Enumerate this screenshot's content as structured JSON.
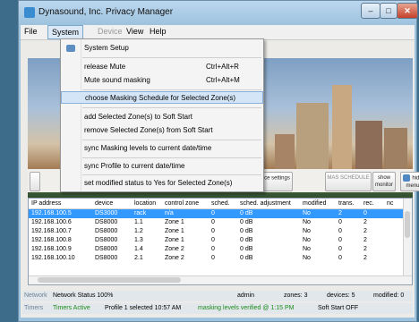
{
  "window": {
    "title": "Dynasound, Inc. Privacy Manager"
  },
  "menubar": {
    "file": "File",
    "system": "System",
    "device": "Device",
    "view": "View",
    "help": "Help"
  },
  "system_menu": [
    {
      "label": "System Setup",
      "shortcut": ""
    },
    {
      "label": "release Mute",
      "shortcut": "Ctrl+Alt+R"
    },
    {
      "label": "Mute sound masking",
      "shortcut": "Ctrl+Alt+M"
    },
    {
      "label": "choose Masking Schedule for Selected Zone(s)",
      "shortcut": ""
    },
    {
      "label": "add Selected Zone(s) to Soft Start",
      "shortcut": ""
    },
    {
      "label": "remove Selected Zone(s) from Soft Start",
      "shortcut": ""
    },
    {
      "label": "sync Masking levels to current date/time",
      "shortcut": ""
    },
    {
      "label": "sync Profile to current date/time",
      "shortcut": ""
    },
    {
      "label": "set modified status to Yes for Selected Zone(s)",
      "shortcut": ""
    }
  ],
  "toolbar": {
    "device_settings": "device settings",
    "masking_schedule": "MAS SCHEDULE",
    "show_monitor": "show monitor",
    "hide_menu": "hide menu"
  },
  "table": {
    "columns": [
      "IP address",
      "device",
      "location",
      "control zone",
      "sched.",
      "sched. adjustment",
      "modified",
      "trans.",
      "rec.",
      "nc"
    ],
    "rows": [
      [
        "192.168.100.5",
        "DS3000",
        "rack",
        "n/a",
        "0",
        "0 dB",
        "No",
        "2",
        "0",
        ""
      ],
      [
        "192.168.100.6",
        "DS8000",
        "1.1",
        "Zone 1",
        "0",
        "0 dB",
        "No",
        "0",
        "2",
        ""
      ],
      [
        "192.168.100.7",
        "DS8000",
        "1.2",
        "Zone 1",
        "0",
        "0 dB",
        "No",
        "0",
        "2",
        ""
      ],
      [
        "192.168.100.8",
        "DS8000",
        "1.3",
        "Zone 1",
        "0",
        "0 dB",
        "No",
        "0",
        "2",
        ""
      ],
      [
        "192.168.100.9",
        "DS8000",
        "1.4",
        "Zone 2",
        "0",
        "0 dB",
        "No",
        "0",
        "2",
        ""
      ],
      [
        "192.168.100.10",
        "DS8000",
        "2.1",
        "Zone 2",
        "0",
        "0 dB",
        "No",
        "0",
        "2",
        ""
      ]
    ]
  },
  "status": {
    "network_label": "Network",
    "network_status": "Network Status 100%",
    "admin": "admin",
    "zones": "zones: 3",
    "devices": "devices: 5",
    "modified": "modified: 0",
    "timers_label": "Timers",
    "timers_active": "Timers Active",
    "profile": "Profile 1 selected 10:57 AM",
    "masking_verified": "masking levels verified @ 1:15 PM",
    "soft_start": "Soft Start OFF"
  },
  "colors": {
    "selection": "#3399ff",
    "highlight": "#d4e5f7",
    "status_green": "#1b8a1b"
  }
}
